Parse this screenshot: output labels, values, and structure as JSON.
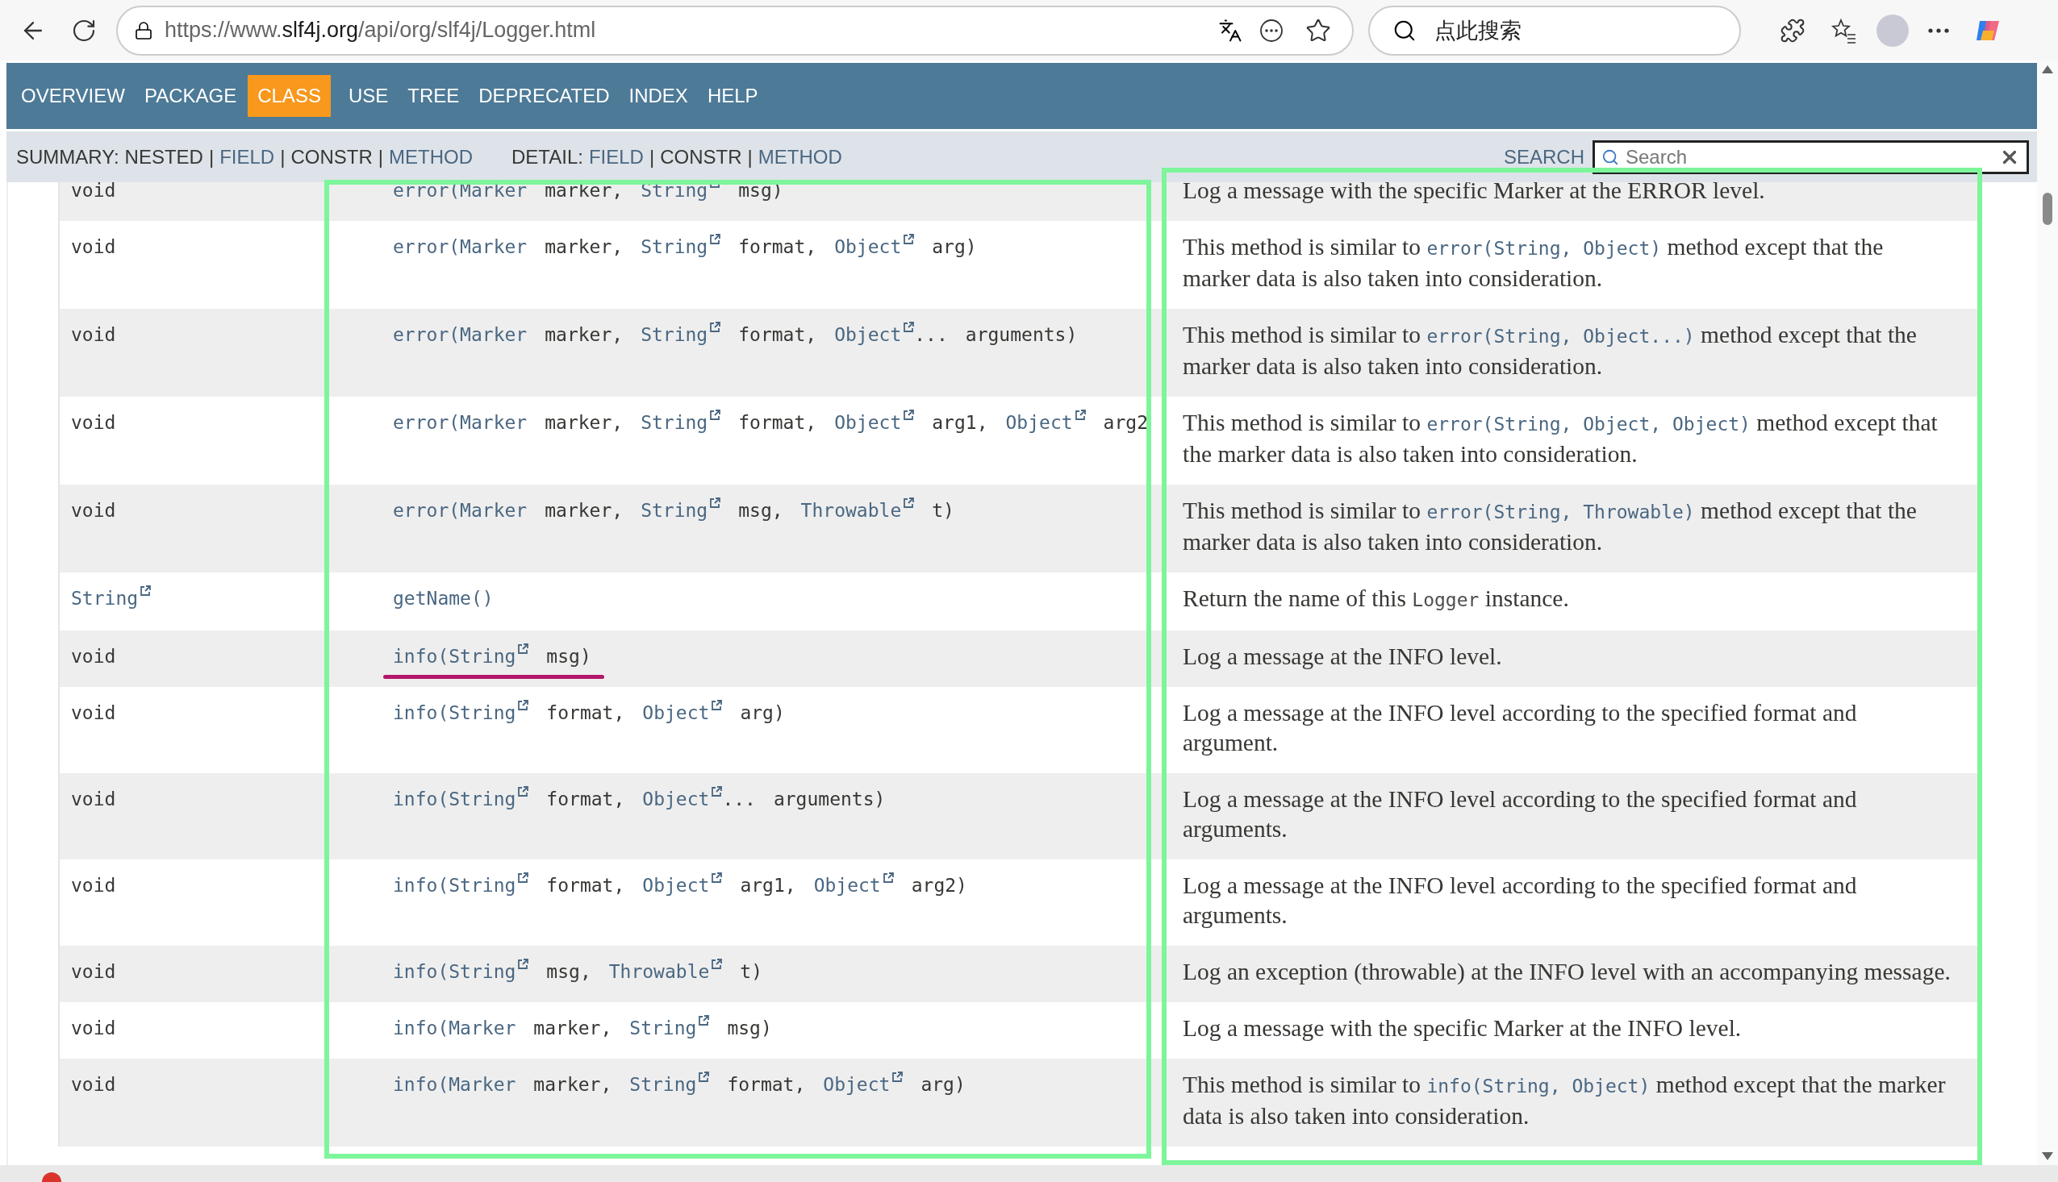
{
  "browser": {
    "url": {
      "scheme": "https://www.",
      "host": "slf4j.org",
      "path": "/api/org/slf4j/Logger.html"
    },
    "search_placeholder": "点此搜索"
  },
  "nav": [
    {
      "label": "OVERVIEW",
      "selected": false
    },
    {
      "label": "PACKAGE",
      "selected": false
    },
    {
      "label": "CLASS",
      "selected": true
    },
    {
      "label": "USE",
      "selected": false
    },
    {
      "label": "TREE",
      "selected": false
    },
    {
      "label": "DEPRECATED",
      "selected": false
    },
    {
      "label": "INDEX",
      "selected": false
    },
    {
      "label": "HELP",
      "selected": false
    }
  ],
  "subnav": {
    "summary": [
      {
        "kind": "label",
        "text": "SUMMARY:"
      },
      {
        "kind": "plain",
        "text": "NESTED"
      },
      {
        "kind": "sep",
        "text": "|"
      },
      {
        "kind": "link",
        "text": "FIELD"
      },
      {
        "kind": "sep",
        "text": "|"
      },
      {
        "kind": "plain",
        "text": "CONSTR"
      },
      {
        "kind": "sep",
        "text": "|"
      },
      {
        "kind": "link",
        "text": "METHOD"
      }
    ],
    "detail": [
      {
        "kind": "label",
        "text": "DETAIL:"
      },
      {
        "kind": "link",
        "text": "FIELD"
      },
      {
        "kind": "sep",
        "text": "|"
      },
      {
        "kind": "plain",
        "text": "CONSTR"
      },
      {
        "kind": "sep",
        "text": "|"
      },
      {
        "kind": "link",
        "text": "METHOD"
      }
    ],
    "search_label": "SEARCH",
    "search_placeholder": "Search"
  },
  "rows": [
    {
      "type": [
        {
          "kind": "text",
          "text": "void"
        }
      ],
      "signature": [
        {
          "kind": "method",
          "text": "error("
        },
        {
          "kind": "type",
          "text": "Marker",
          "joined": true
        },
        {
          "kind": "text",
          "text": "marker,"
        },
        {
          "kind": "ext",
          "text": "String"
        },
        {
          "kind": "text",
          "text": "msg)"
        }
      ],
      "description": [
        {
          "kind": "text",
          "text": "Log a message with the specific Marker at the ERROR level."
        }
      ],
      "underlined": false
    },
    {
      "type": [
        {
          "kind": "text",
          "text": "void"
        }
      ],
      "signature": [
        {
          "kind": "method",
          "text": "error("
        },
        {
          "kind": "type",
          "text": "Marker",
          "joined": true
        },
        {
          "kind": "text",
          "text": "marker,"
        },
        {
          "kind": "ext",
          "text": "String"
        },
        {
          "kind": "text",
          "text": "format,"
        },
        {
          "kind": "ext",
          "text": "Object"
        },
        {
          "kind": "text",
          "text": "arg)"
        }
      ],
      "description": [
        {
          "kind": "text",
          "text": "This method is similar to "
        },
        {
          "kind": "code",
          "text": "error(String, Object)"
        },
        {
          "kind": "text",
          "text": " method except that the marker data is also taken into consideration."
        }
      ],
      "underlined": false
    },
    {
      "type": [
        {
          "kind": "text",
          "text": "void"
        }
      ],
      "signature": [
        {
          "kind": "method",
          "text": "error("
        },
        {
          "kind": "type",
          "text": "Marker",
          "joined": true
        },
        {
          "kind": "text",
          "text": "marker,"
        },
        {
          "kind": "ext",
          "text": "String"
        },
        {
          "kind": "text",
          "text": "format,"
        },
        {
          "kind": "ext",
          "text": "Object"
        },
        {
          "kind": "text",
          "text": "...",
          "joined": true
        },
        {
          "kind": "text",
          "text": "arguments)"
        }
      ],
      "description": [
        {
          "kind": "text",
          "text": "This method is similar to "
        },
        {
          "kind": "code",
          "text": "error(String, Object...)"
        },
        {
          "kind": "text",
          "text": " method except that the marker data is also taken into consideration."
        }
      ],
      "underlined": false
    },
    {
      "type": [
        {
          "kind": "text",
          "text": "void"
        }
      ],
      "signature": [
        {
          "kind": "method",
          "text": "error("
        },
        {
          "kind": "type",
          "text": "Marker",
          "joined": true
        },
        {
          "kind": "text",
          "text": "marker,"
        },
        {
          "kind": "ext",
          "text": "String"
        },
        {
          "kind": "text",
          "text": "format,"
        },
        {
          "kind": "ext",
          "text": "Object"
        },
        {
          "kind": "text",
          "text": "arg1,"
        },
        {
          "kind": "ext",
          "text": "Object"
        },
        {
          "kind": "text",
          "text": "arg2"
        }
      ],
      "description": [
        {
          "kind": "text",
          "text": "This method is similar to "
        },
        {
          "kind": "code",
          "text": "error(String, Object, Object)"
        },
        {
          "kind": "text",
          "text": " method except that the marker data is also taken into consideration."
        }
      ],
      "underlined": false
    },
    {
      "type": [
        {
          "kind": "text",
          "text": "void"
        }
      ],
      "signature": [
        {
          "kind": "method",
          "text": "error("
        },
        {
          "kind": "type",
          "text": "Marker",
          "joined": true
        },
        {
          "kind": "text",
          "text": "marker,"
        },
        {
          "kind": "ext",
          "text": "String"
        },
        {
          "kind": "text",
          "text": "msg,"
        },
        {
          "kind": "ext",
          "text": "Throwable"
        },
        {
          "kind": "text",
          "text": "t)"
        }
      ],
      "description": [
        {
          "kind": "text",
          "text": "This method is similar to "
        },
        {
          "kind": "code",
          "text": "error(String, Throwable)"
        },
        {
          "kind": "text",
          "text": " method except that the marker data is also taken into consideration."
        }
      ],
      "underlined": false
    },
    {
      "type": [
        {
          "kind": "ext",
          "text": "String"
        }
      ],
      "signature": [
        {
          "kind": "method",
          "text": "getName()"
        }
      ],
      "description": [
        {
          "kind": "text",
          "text": "Return the name of this "
        },
        {
          "kind": "code_plain",
          "text": "Logger"
        },
        {
          "kind": "text",
          "text": " instance."
        }
      ],
      "underlined": false
    },
    {
      "type": [
        {
          "kind": "text",
          "text": "void"
        }
      ],
      "signature": [
        {
          "kind": "method",
          "text": "info("
        },
        {
          "kind": "ext",
          "text": "String",
          "joined": true
        },
        {
          "kind": "text",
          "text": "msg)"
        }
      ],
      "description": [
        {
          "kind": "text",
          "text": "Log a message at the INFO level."
        }
      ],
      "underlined": true
    },
    {
      "type": [
        {
          "kind": "text",
          "text": "void"
        }
      ],
      "signature": [
        {
          "kind": "method",
          "text": "info("
        },
        {
          "kind": "ext",
          "text": "String",
          "joined": true
        },
        {
          "kind": "text",
          "text": "format,"
        },
        {
          "kind": "ext",
          "text": "Object"
        },
        {
          "kind": "text",
          "text": "arg)"
        }
      ],
      "description": [
        {
          "kind": "text",
          "text": "Log a message at the INFO level according to the specified format and argument."
        }
      ],
      "underlined": false
    },
    {
      "type": [
        {
          "kind": "text",
          "text": "void"
        }
      ],
      "signature": [
        {
          "kind": "method",
          "text": "info("
        },
        {
          "kind": "ext",
          "text": "String",
          "joined": true
        },
        {
          "kind": "text",
          "text": "format,"
        },
        {
          "kind": "ext",
          "text": "Object"
        },
        {
          "kind": "text",
          "text": "...",
          "joined": true
        },
        {
          "kind": "text",
          "text": "arguments)"
        }
      ],
      "description": [
        {
          "kind": "text",
          "text": "Log a message at the INFO level according to the specified format and arguments."
        }
      ],
      "underlined": false
    },
    {
      "type": [
        {
          "kind": "text",
          "text": "void"
        }
      ],
      "signature": [
        {
          "kind": "method",
          "text": "info("
        },
        {
          "kind": "ext",
          "text": "String",
          "joined": true
        },
        {
          "kind": "text",
          "text": "format,"
        },
        {
          "kind": "ext",
          "text": "Object"
        },
        {
          "kind": "text",
          "text": "arg1,"
        },
        {
          "kind": "ext",
          "text": "Object"
        },
        {
          "kind": "text",
          "text": "arg2)"
        }
      ],
      "description": [
        {
          "kind": "text",
          "text": "Log a message at the INFO level according to the specified format and arguments."
        }
      ],
      "underlined": false
    },
    {
      "type": [
        {
          "kind": "text",
          "text": "void"
        }
      ],
      "signature": [
        {
          "kind": "method",
          "text": "info("
        },
        {
          "kind": "ext",
          "text": "String",
          "joined": true
        },
        {
          "kind": "text",
          "text": "msg,"
        },
        {
          "kind": "ext",
          "text": "Throwable"
        },
        {
          "kind": "text",
          "text": "t)"
        }
      ],
      "description": [
        {
          "kind": "text",
          "text": "Log an exception (throwable) at the INFO level with an accompanying message."
        }
      ],
      "underlined": false
    },
    {
      "type": [
        {
          "kind": "text",
          "text": "void"
        }
      ],
      "signature": [
        {
          "kind": "method",
          "text": "info("
        },
        {
          "kind": "type",
          "text": "Marker",
          "joined": true
        },
        {
          "kind": "text",
          "text": "marker,"
        },
        {
          "kind": "ext",
          "text": "String"
        },
        {
          "kind": "text",
          "text": "msg)"
        }
      ],
      "description": [
        {
          "kind": "text",
          "text": "Log a message with the specific Marker at the INFO level."
        }
      ],
      "underlined": false
    },
    {
      "type": [
        {
          "kind": "text",
          "text": "void"
        }
      ],
      "signature": [
        {
          "kind": "method",
          "text": "info("
        },
        {
          "kind": "type",
          "text": "Marker",
          "joined": true
        },
        {
          "kind": "text",
          "text": "marker,"
        },
        {
          "kind": "ext",
          "text": "String"
        },
        {
          "kind": "text",
          "text": "format,"
        },
        {
          "kind": "ext",
          "text": "Object"
        },
        {
          "kind": "text",
          "text": "arg)"
        }
      ],
      "description": [
        {
          "kind": "text",
          "text": "This method is similar to "
        },
        {
          "kind": "code",
          "text": "info(String, Object)"
        },
        {
          "kind": "text",
          "text": " method except that the marker data is also taken into consideration."
        }
      ],
      "underlined": false
    }
  ]
}
